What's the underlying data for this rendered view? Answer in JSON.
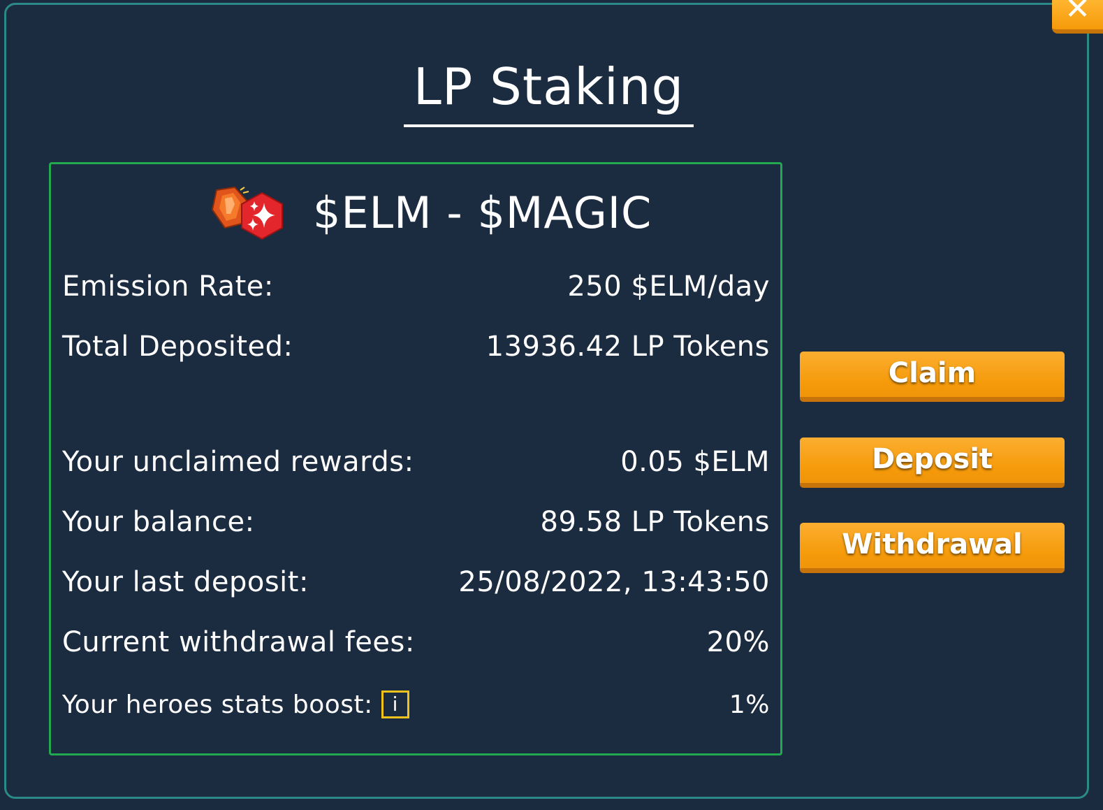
{
  "modal": {
    "title": "LP Staking",
    "close_label": "✕"
  },
  "pool": {
    "name": "$ELM - $MAGIC",
    "icons": [
      "elm-gem-icon",
      "magic-sparkle-icon"
    ],
    "rows": [
      {
        "label": "Emission Rate:",
        "value": "250 $ELM/day"
      },
      {
        "label": "Total Deposited:",
        "value": "13936.42 LP Tokens"
      },
      {
        "label": "Your unclaimed rewards:",
        "value": "0.05 $ELM"
      },
      {
        "label": "Your balance:",
        "value": "89.58 LP Tokens"
      },
      {
        "label": "Your last deposit:",
        "value": "25/08/2022, 13:43:50"
      },
      {
        "label": "Current withdrawal fees:",
        "value": "20%"
      },
      {
        "label": "Your heroes stats boost:",
        "value": "1%",
        "info": "i"
      }
    ]
  },
  "actions": {
    "claim": "Claim",
    "deposit": "Deposit",
    "withdrawal": "Withdrawal"
  },
  "colors": {
    "background": "#1b2b40",
    "modal_border": "#2b8a87",
    "pool_border": "#22a84f",
    "button": "#f59a0a",
    "info_border": "#f2c21d"
  }
}
